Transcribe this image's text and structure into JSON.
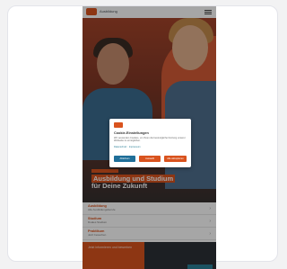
{
  "header": {
    "brand": "Ausbildung",
    "menu_icon": "hamburger-menu-icon"
  },
  "hero": {
    "tag": "",
    "headline_line1": "Ausbildung und Studium",
    "headline_line2": "für Deine Zukunft"
  },
  "list": {
    "items": [
      {
        "title": "Ausbildung",
        "sub": "Alle Ausbildungsberufe"
      },
      {
        "title": "Studium",
        "sub": "Duales Studium"
      },
      {
        "title": "Praktikum",
        "sub": "Jetzt bewerben"
      }
    ]
  },
  "promo": {
    "text": "Jetzt informieren und bewerben"
  },
  "dialog": {
    "title": "Cookie-Einstellungen",
    "text": "Wir verwenden Cookies, um Ihnen die bestmögliche Nutzung unserer Webseite zu ermöglichen.",
    "link": "Datenschutz · Impressum",
    "buttons": [
      "Ablehnen",
      "Auswahl",
      "Alle akzeptieren"
    ]
  },
  "colors": {
    "accent": "#d9531e",
    "teal": "#2a7f96",
    "blue": "#1f6f99"
  }
}
